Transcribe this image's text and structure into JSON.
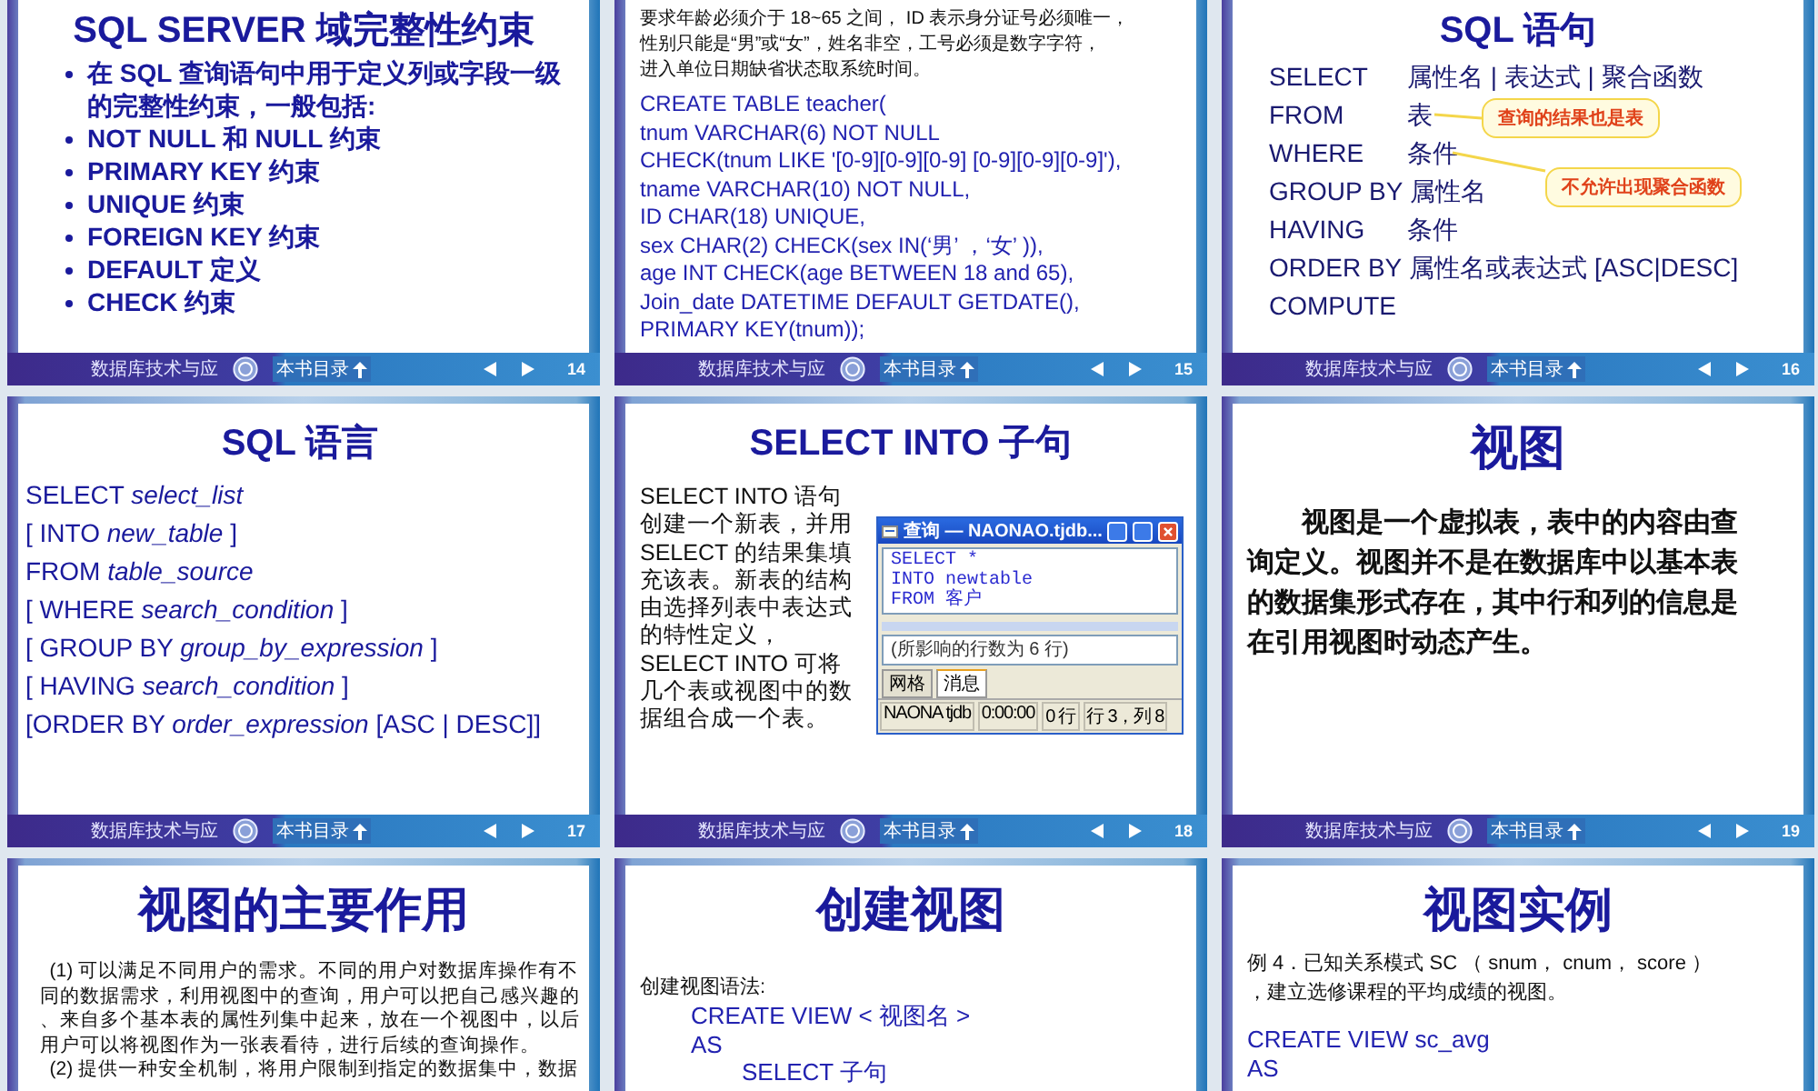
{
  "slides": [
    {
      "kind": "bullets",
      "title": "SQL SERVER 域完整性约束",
      "blocks": [
        {
          "kind": "bullet",
          "text": "在 SQL 查询语句中用于定义列或字段一级的完整性约束，一般包括:"
        },
        {
          "kind": "bullet",
          "text": "NOT NULL 和 NULL 约束"
        },
        {
          "kind": "bullet",
          "text": "PRIMARY KEY 约束"
        },
        {
          "kind": "bullet",
          "text": "UNIQUE 约束"
        },
        {
          "kind": "bullet",
          "text": "FOREIGN KEY 约束"
        },
        {
          "kind": "bullet",
          "text": "DEFAULT 定义"
        },
        {
          "kind": "bullet",
          "text": "CHECK 约束"
        }
      ],
      "footer": {
        "title": "数据库技术与应",
        "toc": "本书目录",
        "page": "14"
      }
    },
    {
      "kind": "code",
      "blocks": [
        {
          "kind": "note",
          "lines": [
            "要求年龄必须介于 18~65 之间， ID 表示身分证号必须唯一，",
            "性别只能是“男”或“女”，姓名非空，工号必须是数字字符，",
            "进入单位日期缺省状态取系统时间。"
          ]
        },
        {
          "kind": "code",
          "text": "CREATE TABLE teacher("
        },
        {
          "kind": "code",
          "text": "tnum VARCHAR(6) NOT NULL"
        },
        {
          "kind": "code",
          "text": "CHECK(tnum LIKE '[0-9][0-9][0-9] [0-9][0-9][0-9]'),"
        },
        {
          "kind": "code",
          "text": "tname VARCHAR(10)  NOT NULL,"
        },
        {
          "kind": "code",
          "text": "ID  CHAR(18)  UNIQUE,"
        },
        {
          "kind": "code",
          "text": "sex CHAR(2)  CHECK(sex IN(‘男’ ，‘女’ )),"
        },
        {
          "kind": "code",
          "text": "age  INT  CHECK(age BETWEEN 18 and 65),"
        },
        {
          "kind": "code",
          "text": "Join_date DATETIME DEFAULT GETDATE(),"
        },
        {
          "kind": "code",
          "text": "PRIMARY KEY(tnum));"
        }
      ],
      "footer": {
        "title": "数据库技术与应",
        "toc": "本书目录",
        "page": "15"
      }
    },
    {
      "kind": "clauses",
      "title": "SQL 语句",
      "blocks": [
        {
          "kind": "clause",
          "keyword": "SELECT",
          "value": "属性名 | 表达式 | 聚合函数"
        },
        {
          "kind": "clause",
          "keyword": "FROM",
          "value": "表"
        },
        {
          "kind": "clause",
          "keyword": "WHERE",
          "value": "条件"
        },
        {
          "kind": "clause",
          "keyword": "GROUP  BY",
          "value": "属性名"
        },
        {
          "kind": "clause",
          "keyword": "HAVING",
          "value": "条件"
        },
        {
          "kind": "clause",
          "keyword": "ORDER BY",
          "value": "属性名或表达式  [ASC|DESC]"
        },
        {
          "kind": "clause",
          "keyword": "COMPUTE"
        }
      ],
      "callouts": [
        {
          "text": "查询的结果也是表"
        },
        {
          "text": "不允许出现聚合函数"
        }
      ],
      "footer": {
        "title": "数据库技术与应",
        "toc": "本书目录",
        "page": "16"
      }
    },
    {
      "kind": "syntax",
      "title": "SQL 语言",
      "blocks": [
        {
          "kind": "syntax",
          "text": "SELECT *select_list*"
        },
        {
          "kind": "syntax",
          "text": "[ INTO *new_table* ]"
        },
        {
          "kind": "syntax",
          "text": "FROM *table_source*"
        },
        {
          "kind": "syntax",
          "text": "[ WHERE *search_condition* ]"
        },
        {
          "kind": "syntax",
          "text": "[ GROUP BY *group_by_expression* ]"
        },
        {
          "kind": "syntax",
          "text": "[ HAVING *search_condition* ]"
        },
        {
          "kind": "syntax",
          "text": "[ORDER BY *order_expression* [ASC | DESC]]"
        }
      ],
      "footer": {
        "title": "数据库技术与应",
        "toc": "本书目录",
        "page": "17"
      }
    },
    {
      "kind": "figure",
      "title": "SELECT   INTO 子句",
      "blocks": [
        {
          "kind": "description",
          "lines": [
            "SELECT INTO  语句",
            "创建一个新表，并用",
            "SELECT  的结果集填",
            "充该表。新表的结构",
            "由选择列表中表达式",
            "的特性定义，",
            "SELECT  INTO  可将",
            "几个表或视图中的数",
            "据组合成一个表。"
          ]
        }
      ],
      "window": {
        "title": "查询 — NAONAO.tjdb...",
        "code": [
          "SELECT *",
          "INTO newtable",
          "FROM 客户"
        ],
        "message": "(所影响的行数为 6 行)",
        "tabs": [
          {
            "label": "网格",
            "selected": false
          },
          {
            "label": "消息",
            "selected": true
          }
        ],
        "status": [
          "NAONA tjdb",
          "0:00:00",
          "0 行",
          "行 3，列 8"
        ]
      },
      "footer": {
        "title": "数据库技术与应",
        "toc": "本书目录",
        "page": "18"
      }
    },
    {
      "kind": "paragraph",
      "title": "视图",
      "blocks": [
        {
          "kind": "paragraph",
          "lines": [
            "视图是一个虚拟表，表中的内容由查",
            "询定义。视图并不是在数据库中以基本表",
            "的数据集形式存在，其中行和列的信息是",
            "在引用视图时动态产生。"
          ]
        }
      ],
      "footer": {
        "title": "数据库技术与应",
        "toc": "本书目录",
        "page": "19"
      }
    },
    {
      "kind": "paragraphs",
      "title": "视图的主要作用",
      "blocks": [
        {
          "kind": "small_paragraph",
          "lines": [
            "(1) 可以满足不同用户的需求。不同的用户对数据库操作有不",
            "同的数据需求，利用视图中的查询，用户可以把自己感兴趣的",
            "、来自多个基本表的属性列集中起来，放在一个视图中，以后",
            "用户可以将视图作为一张表看待，进行后续的查询操作。"
          ]
        },
        {
          "kind": "small_paragraph",
          "lines": [
            "(2) 提供一种安全机制，将用户限制到指定的数据集中，数据"
          ]
        }
      ]
    },
    {
      "kind": "tree",
      "title": "创建视图",
      "blocks": [
        {
          "kind": "label",
          "text": "创建视图语法:",
          "children": [
            {
              "kind": "code",
              "text": "CREATE VIEW < 视图名 >"
            },
            {
              "kind": "code",
              "text": "AS",
              "children": [
                {
                  "kind": "code",
                  "text": "SELECT  子句"
                }
              ]
            }
          ]
        }
      ]
    },
    {
      "kind": "example",
      "title": "视图实例",
      "blocks": [
        {
          "kind": "note",
          "lines": [
            "例 4．已知关系模式 SC （ snum， cnum， score ）",
            "，建立选修课程的平均成绩的视图。"
          ]
        },
        {
          "kind": "code",
          "text": "CREATE VIEW sc_avg"
        },
        {
          "kind": "code",
          "text": "AS"
        }
      ]
    }
  ]
}
